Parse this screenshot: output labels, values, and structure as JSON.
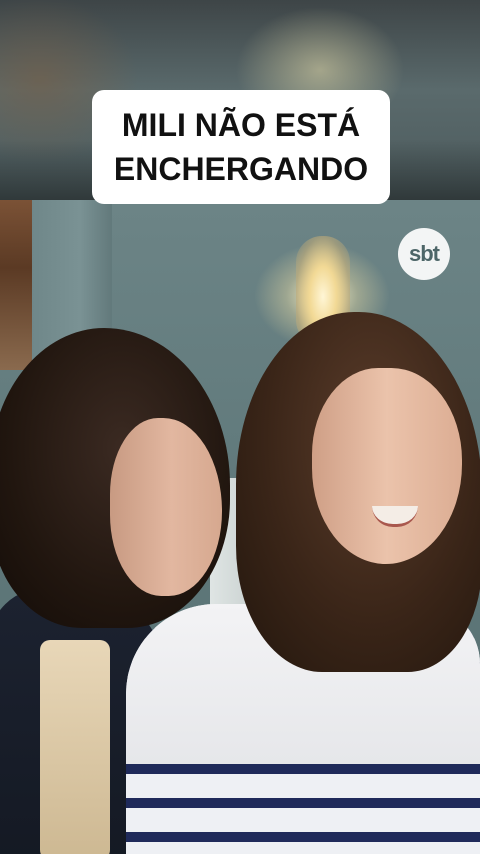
{
  "caption": {
    "line1": "MILI NÃO ESTÁ",
    "line2": "ENCHERGANDO"
  },
  "watermark": {
    "logo_text": "sbt"
  },
  "colors": {
    "caption_bg": "#ffffff",
    "caption_text": "#111111",
    "logo_bg": "#ffffff"
  }
}
